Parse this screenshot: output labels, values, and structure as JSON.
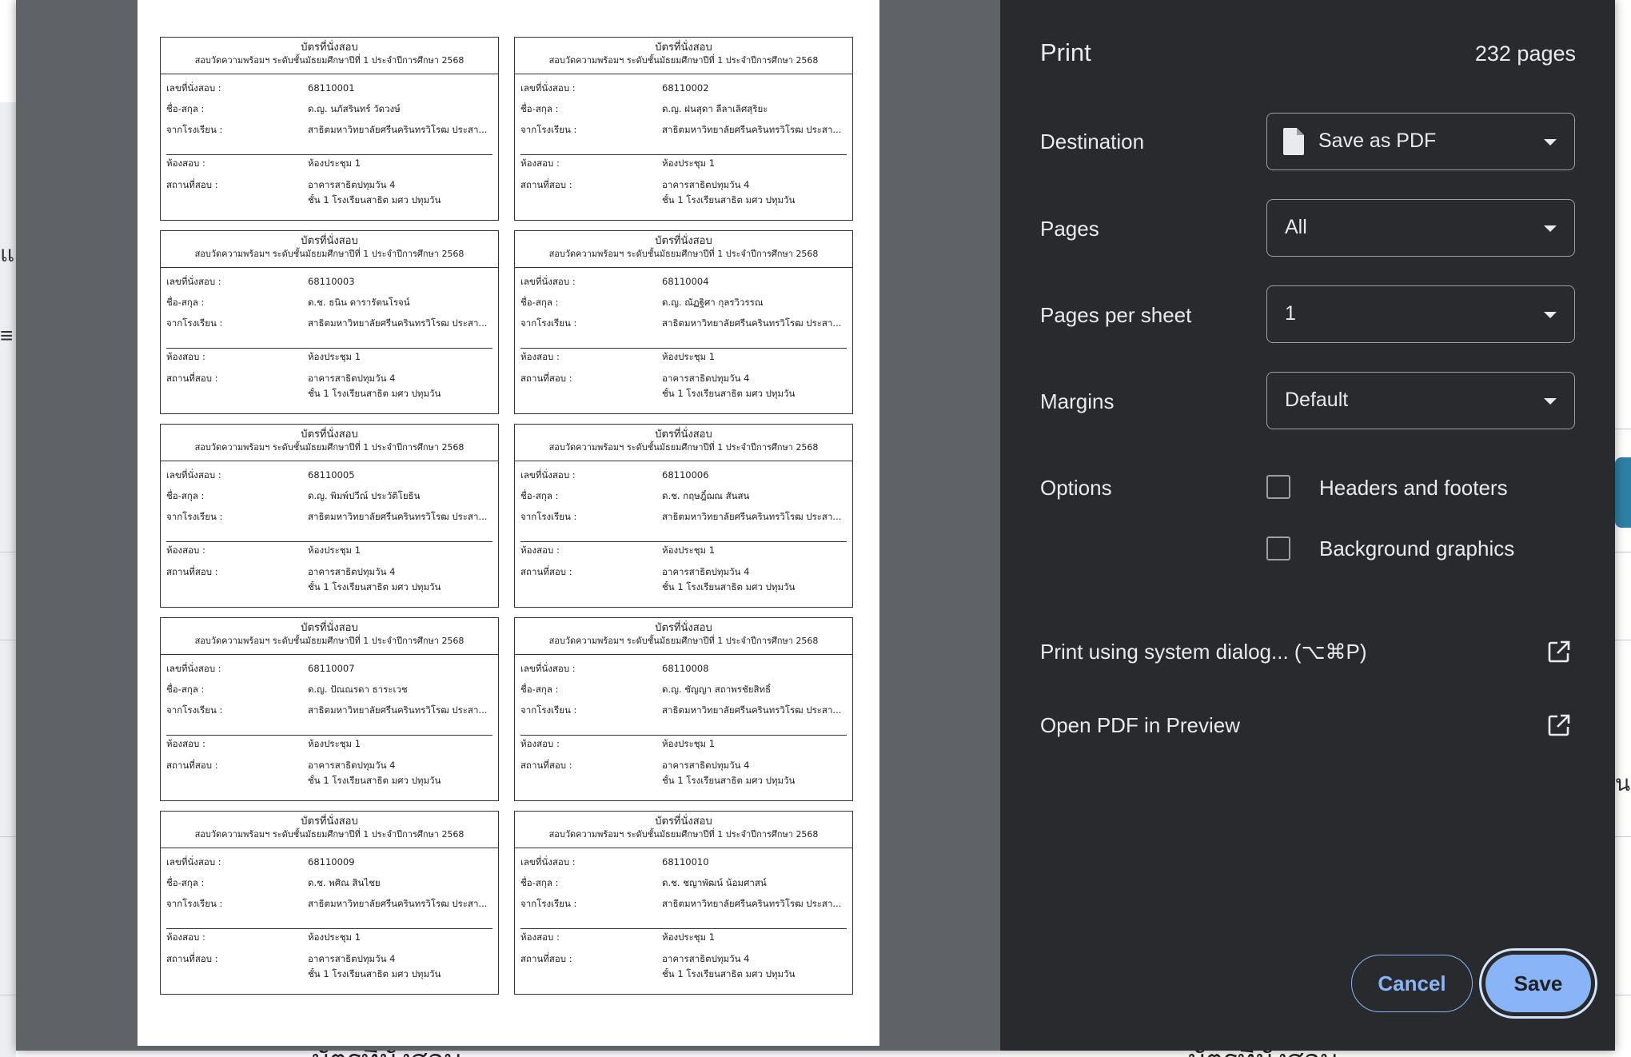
{
  "dialog": {
    "title": "Print",
    "page_count": "232 pages",
    "destination": {
      "label": "Destination",
      "value": "Save as PDF"
    },
    "pages": {
      "label": "Pages",
      "value": "All"
    },
    "pages_per_sheet": {
      "label": "Pages per sheet",
      "value": "1"
    },
    "margins": {
      "label": "Margins",
      "value": "Default"
    },
    "options": {
      "label": "Options",
      "headers_footers": {
        "label": "Headers and footers",
        "checked": false
      },
      "background_graphics": {
        "label": "Background graphics",
        "checked": false
      }
    },
    "system_dialog": "Print using system dialog... (⌥⌘P)",
    "open_preview": "Open PDF in Preview",
    "cancel": "Cancel",
    "save": "Save"
  },
  "card_labels": {
    "title": "บัตรที่นั่งสอบ",
    "subtitle": "สอบวัดความพร้อมฯ ระดับชั้นมัธยมศึกษาปีที่ 1 ประจำปีการศึกษา 2568",
    "seat": "เลขที่นั่งสอบ :",
    "name": "ชื่อ-สกุล :",
    "school": "จากโรงเรียน :",
    "room": "ห้องสอบ :",
    "venue": "สถานที่สอบ :"
  },
  "cards": [
    {
      "seat": "68110001",
      "name": "ด.ญ. นภัสรินทร์ วัดวงษ์",
      "school": "สาธิตมหาวิทยาลัยศรีนครินทรวิโรฒ ประสา...",
      "room": "ห้องประชุม 1",
      "venue1": "อาคารสาธิตปทุมวัน 4",
      "venue2": "ชั้น 1 โรงเรียนสาธิต มศว ปทุมวัน"
    },
    {
      "seat": "68110002",
      "name": "ด.ญ. ฝนสุดา ลีลาเลิศสุริยะ",
      "school": "สาธิตมหาวิทยาลัยศรีนครินทรวิโรฒ ประสา...",
      "room": "ห้องประชุม 1",
      "venue1": "อาคารสาธิตปทุมวัน 4",
      "venue2": "ชั้น 1 โรงเรียนสาธิต มศว ปทุมวัน"
    },
    {
      "seat": "68110003",
      "name": "ด.ช. ธนิน ดารารัตนโรจน์",
      "school": "สาธิตมหาวิทยาลัยศรีนครินทรวิโรฒ ประสา...",
      "room": "ห้องประชุม 1",
      "venue1": "อาคารสาธิตปทุมวัน 4",
      "venue2": "ชั้น 1 โรงเรียนสาธิต มศว ปทุมวัน"
    },
    {
      "seat": "68110004",
      "name": "ด.ญ. ณัฏฐิศา กุลรวิวรรณ",
      "school": "สาธิตมหาวิทยาลัยศรีนครินทรวิโรฒ ประสา...",
      "room": "ห้องประชุม 1",
      "venue1": "อาคารสาธิตปทุมวัน 4",
      "venue2": "ชั้น 1 โรงเรียนสาธิต มศว ปทุมวัน"
    },
    {
      "seat": "68110005",
      "name": "ด.ญ. พิมพ์ปวีณ์ ประวัติโยธิน",
      "school": "สาธิตมหาวิทยาลัยศรีนครินทรวิโรฒ ประสา...",
      "room": "ห้องประชุม 1",
      "venue1": "อาคารสาธิตปทุมวัน 4",
      "venue2": "ชั้น 1 โรงเรียนสาธิต มศว ปทุมวัน"
    },
    {
      "seat": "68110006",
      "name": "ด.ช. กฤษฎิ์ฌณ สันสน",
      "school": "สาธิตมหาวิทยาลัยศรีนครินทรวิโรฒ ประสา...",
      "room": "ห้องประชุม 1",
      "venue1": "อาคารสาธิตปทุมวัน 4",
      "venue2": "ชั้น 1 โรงเรียนสาธิต มศว ปทุมวัน"
    },
    {
      "seat": "68110007",
      "name": "ด.ญ. ปัณณรดา ธาระเวช",
      "school": "สาธิตมหาวิทยาลัยศรีนครินทรวิโรฒ ประสา...",
      "room": "ห้องประชุม 1",
      "venue1": "อาคารสาธิตปทุมวัน 4",
      "venue2": "ชั้น 1 โรงเรียนสาธิต มศว ปทุมวัน"
    },
    {
      "seat": "68110008",
      "name": "ด.ญ. ชัญญา สถาพรชัยสิทธิ์",
      "school": "สาธิตมหาวิทยาลัยศรีนครินทรวิโรฒ ประสา...",
      "room": "ห้องประชุม 1",
      "venue1": "อาคารสาธิตปทุมวัน 4",
      "venue2": "ชั้น 1 โรงเรียนสาธิต มศว ปทุมวัน"
    },
    {
      "seat": "68110009",
      "name": "ด.ช. พศิณ สินไชย",
      "school": "สาธิตมหาวิทยาลัยศรีนครินทรวิโรฒ ประสา...",
      "room": "ห้องประชุม 1",
      "venue1": "อาคารสาธิตปทุมวัน 4",
      "venue2": "ชั้น 1 โรงเรียนสาธิต มศว ปทุมวัน"
    },
    {
      "seat": "68110010",
      "name": "ด.ช. ชญาพัฒน์ น้อมศาสน์",
      "school": "สาธิตมหาวิทยาลัยศรีนครินทรวิโรฒ ประสา...",
      "room": "ห้องประชุม 1",
      "venue1": "อาคารสาธิตปทุมวัน 4",
      "venue2": "ชั้น 1 โรงเรียนสาธิต มศว ปทุมวัน"
    }
  ],
  "background_page": {
    "glyph_1": "แ",
    "glyph_2": "≡",
    "glyph_3": "น",
    "bottom_text": "บัตรที่นั่งสอบ"
  },
  "colors": {
    "panel_bg": "#292a2d",
    "preview_bg": "#5f6368",
    "accent": "#8ab4f8",
    "text": "#e8eaed"
  },
  "icons": {
    "destination": "file-icon",
    "select": "caret-down-icon",
    "external": "open-external-icon"
  }
}
